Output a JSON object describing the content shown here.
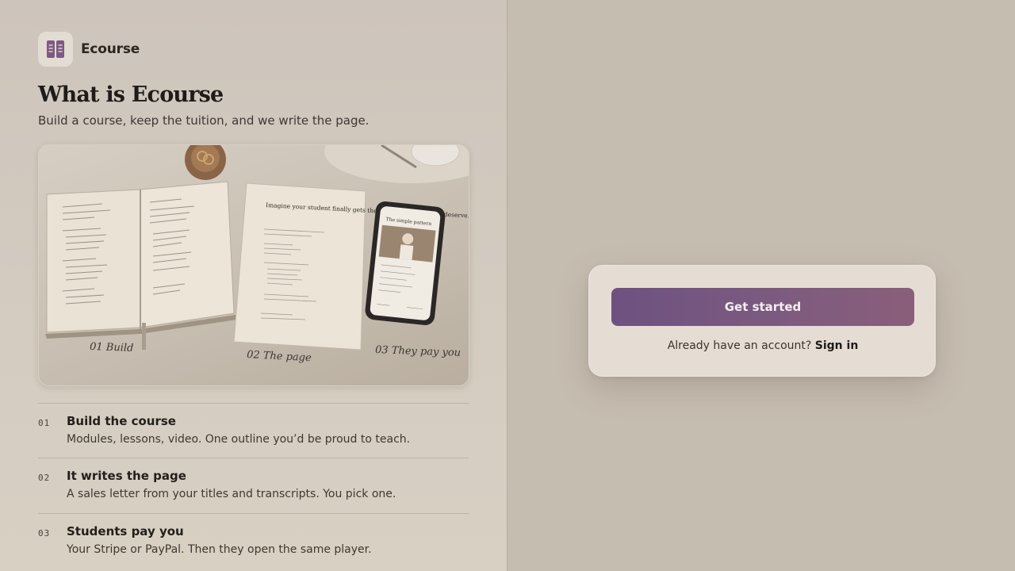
{
  "brand": {
    "name": "Ecourse",
    "logo_icon": "book-icon",
    "logo_color": "#7e5a82"
  },
  "hero_section": {
    "title": "What is Ecourse",
    "subtitle": "Build a course, keep the tuition, and we write the page."
  },
  "hero_image": {
    "captions": [
      "01 Build",
      "02 The page",
      "03 They pay you"
    ],
    "page_heading": "Imagine your student finally gets the result you know they deserve.",
    "phone_title": "The simple pattern"
  },
  "steps": [
    {
      "num": "01",
      "title": "Build the course",
      "desc": "Modules, lessons, video. One outline you’d be proud to teach."
    },
    {
      "num": "02",
      "title": "It writes the page",
      "desc": "A sales letter from your titles and transcripts. You pick one."
    },
    {
      "num": "03",
      "title": "Students pay you",
      "desc": "Your Stripe or PayPal. Then they open the same player."
    }
  ],
  "auth": {
    "cta_label": "Get started",
    "signin_prompt": "Already have an account?",
    "signin_label": "Sign in"
  },
  "colors": {
    "accent_start": "#6e5180",
    "accent_end": "#8a5e7a",
    "background": "#c6bdb1",
    "card": "#e5ddd3"
  }
}
